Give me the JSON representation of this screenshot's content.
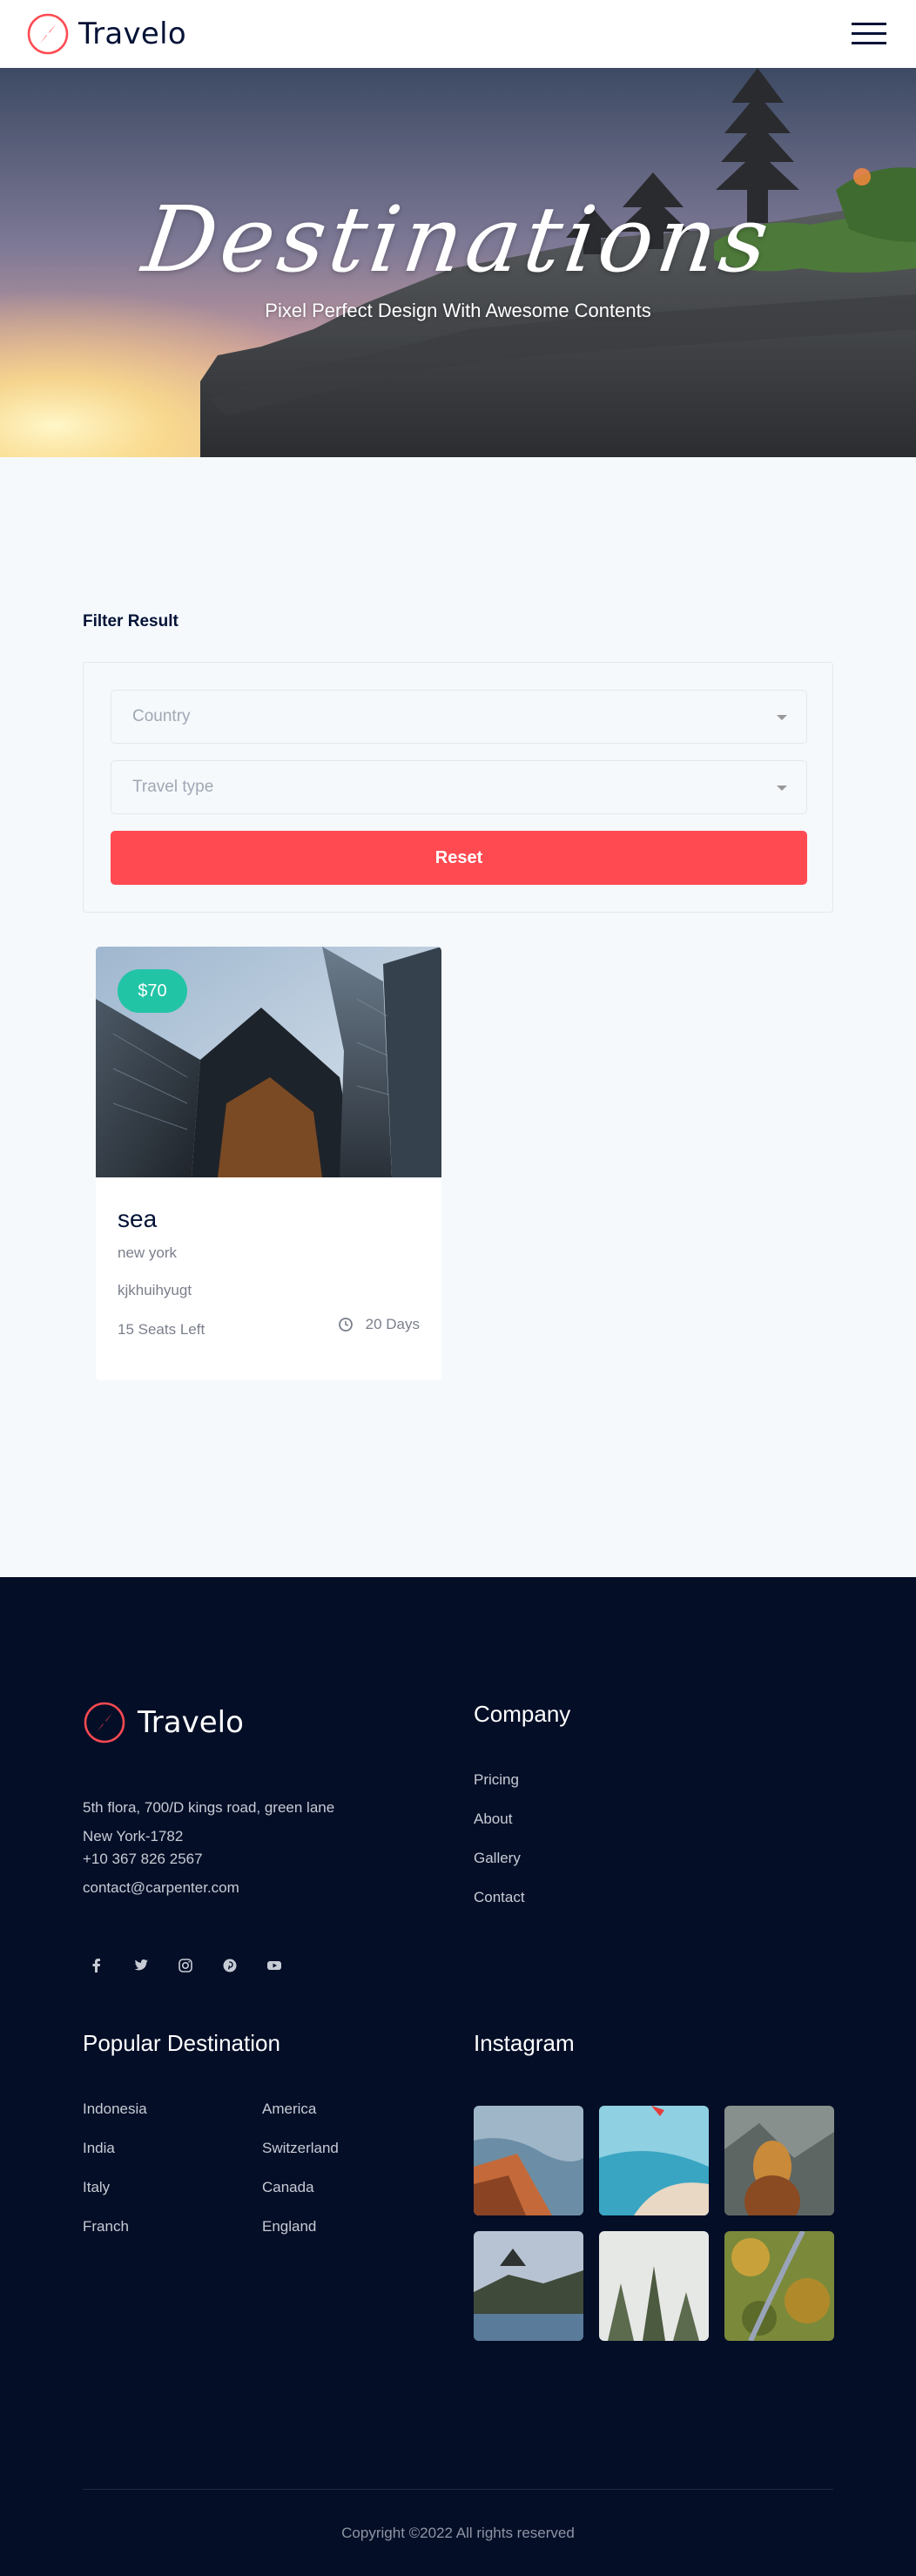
{
  "header": {
    "brand": "Travelo",
    "menu_icon": "hamburger-menu-icon",
    "logo_icon": "compass-icon"
  },
  "hero": {
    "title": "Destinations",
    "subtitle": "Pixel Perfect Design With Awesome Contents"
  },
  "filter": {
    "heading": "Filter Result",
    "country_placeholder": "Country",
    "travel_type_placeholder": "Travel type",
    "reset_label": "Reset"
  },
  "cards": [
    {
      "price": "$70",
      "name": "sea",
      "location": "new york",
      "description": "kjkhuihyugt",
      "seats": "15 Seats Left",
      "days": "20 Days"
    }
  ],
  "footer": {
    "brand": "Travelo",
    "address": "5th flora, 700/D kings road, green lane New York-1782",
    "phone": "+10 367 826 2567",
    "email": "contact@carpenter.com",
    "socials": [
      "facebook-icon",
      "twitter-icon",
      "instagram-icon",
      "pinterest-icon",
      "youtube-icon"
    ],
    "company": {
      "heading": "Company",
      "links": [
        "Pricing",
        "About",
        "Gallery",
        "Contact"
      ]
    },
    "popular": {
      "heading": "Popular Destination",
      "col1": [
        "Indonesia",
        "India",
        "Italy",
        "Franch"
      ],
      "col2": [
        "America",
        "Switzerland",
        "Canada",
        "England"
      ]
    },
    "instagram": {
      "heading": "Instagram"
    },
    "copyright": "Copyright ©2022 All rights reserved"
  },
  "colors": {
    "accent_red": "#ff4a52",
    "badge_teal": "#22c4a6",
    "navy": "#041236",
    "footer_bg": "#040e27",
    "page_bg": "#f5f9fc"
  }
}
